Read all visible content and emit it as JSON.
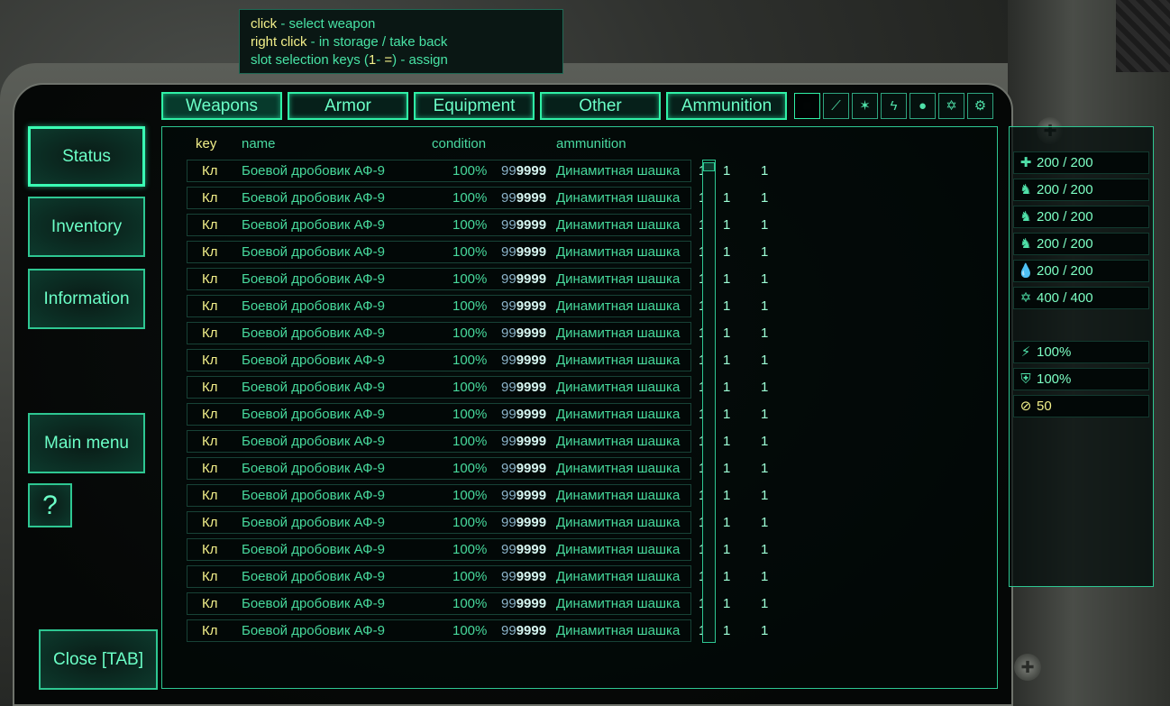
{
  "hint": {
    "line1_key": "click",
    "line1_rest": " - select weapon",
    "line2_key": "right click",
    "line2_rest": " - in storage / take back",
    "line3_a": "slot selection keys (",
    "line3_key": "1",
    "line3_mid": "- ",
    "line3_key2": "=",
    "line3_b": ") - assign"
  },
  "tabs": [
    "Weapons",
    "Armor",
    "Equipment",
    "Other",
    "Ammunition"
  ],
  "filter_icons": [
    "all-filter",
    "melee-filter",
    "ranged-filter",
    "energy-filter",
    "explosive-filter",
    "magic-filter",
    "misc-filter"
  ],
  "side": {
    "status": "Status",
    "inventory": "Inventory",
    "information": "Information",
    "main_menu": "Main menu",
    "help": "?",
    "close": "Close [TAB]"
  },
  "headers": {
    "key": "key",
    "name": "name",
    "condition": "condition",
    "ammunition": "ammunition"
  },
  "rows": [
    {
      "key": "Кл",
      "name": "Боевой дробовик АФ-9",
      "condition": "100%",
      "ammo_dim": "99",
      "ammo_bold": "9999",
      "ammo_type": "Динамитная шашка",
      "c1": "1",
      "c2": "1",
      "c3": "1"
    },
    {
      "key": "Кл",
      "name": "Боевой дробовик АФ-9",
      "condition": "100%",
      "ammo_dim": "99",
      "ammo_bold": "9999",
      "ammo_type": "Динамитная шашка",
      "c1": "1",
      "c2": "1",
      "c3": "1"
    },
    {
      "key": "Кл",
      "name": "Боевой дробовик АФ-9",
      "condition": "100%",
      "ammo_dim": "99",
      "ammo_bold": "9999",
      "ammo_type": "Динамитная шашка",
      "c1": "1",
      "c2": "1",
      "c3": "1"
    },
    {
      "key": "Кл",
      "name": "Боевой дробовик АФ-9",
      "condition": "100%",
      "ammo_dim": "99",
      "ammo_bold": "9999",
      "ammo_type": "Динамитная шашка",
      "c1": "1",
      "c2": "1",
      "c3": "1"
    },
    {
      "key": "Кл",
      "name": "Боевой дробовик АФ-9",
      "condition": "100%",
      "ammo_dim": "99",
      "ammo_bold": "9999",
      "ammo_type": "Динамитная шашка",
      "c1": "1",
      "c2": "1",
      "c3": "1"
    },
    {
      "key": "Кл",
      "name": "Боевой дробовик АФ-9",
      "condition": "100%",
      "ammo_dim": "99",
      "ammo_bold": "9999",
      "ammo_type": "Динамитная шашка",
      "c1": "1",
      "c2": "1",
      "c3": "1"
    },
    {
      "key": "Кл",
      "name": "Боевой дробовик АФ-9",
      "condition": "100%",
      "ammo_dim": "99",
      "ammo_bold": "9999",
      "ammo_type": "Динамитная шашка",
      "c1": "1",
      "c2": "1",
      "c3": "1"
    },
    {
      "key": "Кл",
      "name": "Боевой дробовик АФ-9",
      "condition": "100%",
      "ammo_dim": "99",
      "ammo_bold": "9999",
      "ammo_type": "Динамитная шашка",
      "c1": "1",
      "c2": "1",
      "c3": "1"
    },
    {
      "key": "Кл",
      "name": "Боевой дробовик АФ-9",
      "condition": "100%",
      "ammo_dim": "99",
      "ammo_bold": "9999",
      "ammo_type": "Динамитная шашка",
      "c1": "1",
      "c2": "1",
      "c3": "1"
    },
    {
      "key": "Кл",
      "name": "Боевой дробовик АФ-9",
      "condition": "100%",
      "ammo_dim": "99",
      "ammo_bold": "9999",
      "ammo_type": "Динамитная шашка",
      "c1": "1",
      "c2": "1",
      "c3": "1"
    },
    {
      "key": "Кл",
      "name": "Боевой дробовик АФ-9",
      "condition": "100%",
      "ammo_dim": "99",
      "ammo_bold": "9999",
      "ammo_type": "Динамитная шашка",
      "c1": "1",
      "c2": "1",
      "c3": "1"
    },
    {
      "key": "Кл",
      "name": "Боевой дробовик АФ-9",
      "condition": "100%",
      "ammo_dim": "99",
      "ammo_bold": "9999",
      "ammo_type": "Динамитная шашка",
      "c1": "1",
      "c2": "1",
      "c3": "1"
    },
    {
      "key": "Кл",
      "name": "Боевой дробовик АФ-9",
      "condition": "100%",
      "ammo_dim": "99",
      "ammo_bold": "9999",
      "ammo_type": "Динамитная шашка",
      "c1": "1",
      "c2": "1",
      "c3": "1"
    },
    {
      "key": "Кл",
      "name": "Боевой дробовик АФ-9",
      "condition": "100%",
      "ammo_dim": "99",
      "ammo_bold": "9999",
      "ammo_type": "Динамитная шашка",
      "c1": "1",
      "c2": "1",
      "c3": "1"
    },
    {
      "key": "Кл",
      "name": "Боевой дробовик АФ-9",
      "condition": "100%",
      "ammo_dim": "99",
      "ammo_bold": "9999",
      "ammo_type": "Динамитная шашка",
      "c1": "1",
      "c2": "1",
      "c3": "1"
    },
    {
      "key": "Кл",
      "name": "Боевой дробовик АФ-9",
      "condition": "100%",
      "ammo_dim": "99",
      "ammo_bold": "9999",
      "ammo_type": "Динамитная шашка",
      "c1": "1",
      "c2": "1",
      "c3": "1"
    },
    {
      "key": "Кл",
      "name": "Боевой дробовик АФ-9",
      "condition": "100%",
      "ammo_dim": "99",
      "ammo_bold": "9999",
      "ammo_type": "Динамитная шашка",
      "c1": "1",
      "c2": "1",
      "c3": "1"
    },
    {
      "key": "Кл",
      "name": "Боевой дробовик АФ-9",
      "condition": "100%",
      "ammo_dim": "99",
      "ammo_bold": "9999",
      "ammo_type": "Динамитная шашка",
      "c1": "1",
      "c2": "1",
      "c3": "1"
    }
  ],
  "stats": [
    {
      "icon": "health-cross-icon",
      "glyph": "✚",
      "value": "200 / 200"
    },
    {
      "icon": "head-icon",
      "glyph": "♞",
      "value": "200 / 200"
    },
    {
      "icon": "body-icon",
      "glyph": "♞",
      "value": "200 / 200"
    },
    {
      "icon": "legs-icon",
      "glyph": "♞",
      "value": "200 / 200"
    },
    {
      "icon": "blood-drop-icon",
      "glyph": "💧",
      "value": "200 / 200"
    },
    {
      "icon": "mana-star-icon",
      "glyph": "✡",
      "value": "400 / 400"
    },
    {
      "icon": "skill-icon",
      "glyph": "⚡",
      "value": "100%"
    },
    {
      "icon": "armor-shield-icon",
      "glyph": "⛨",
      "value": "100%"
    },
    {
      "icon": "coin-bits-icon",
      "glyph": "⊘",
      "value": "50",
      "yellow": true
    }
  ]
}
